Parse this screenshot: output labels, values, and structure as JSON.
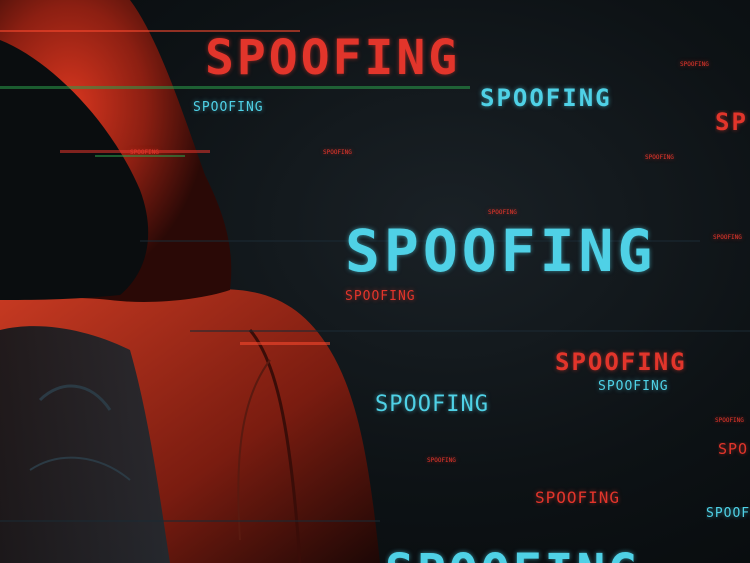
{
  "scene": {
    "description_icon": "hooded-hacker-figure",
    "colors": {
      "red": "#e2352b",
      "cyan": "#4fd1e6",
      "background": "#0b0f12"
    }
  },
  "words": {
    "top_big": "SPOOFING",
    "top_right_cyan": "SPOOFING",
    "top_left_small": "SPOOFING",
    "right_edge_red": "SP",
    "tiny_1": "SPOOFING",
    "tiny_2": "SPOOFING",
    "tiny_3": "SPOOFING",
    "tiny_4": "SPOOFING",
    "tiny_5": "SPOOFING",
    "tiny_6": "SPOOFING",
    "tiny_7": "SPOOFING",
    "tiny_8": "SPOOFING",
    "center_big_cyan": "SPOOFING",
    "center_red_small": "SPOOFING",
    "mid_right_red": "SPOOFING",
    "mid_right_cyan": "SPOOFING",
    "mid_cyan": "SPOOFING",
    "low_red": "SPOOFING",
    "low_right_cyan": "SPOOFING",
    "right_edge_red_2": "SPO",
    "bottom_cyan": "SPOOFING"
  }
}
